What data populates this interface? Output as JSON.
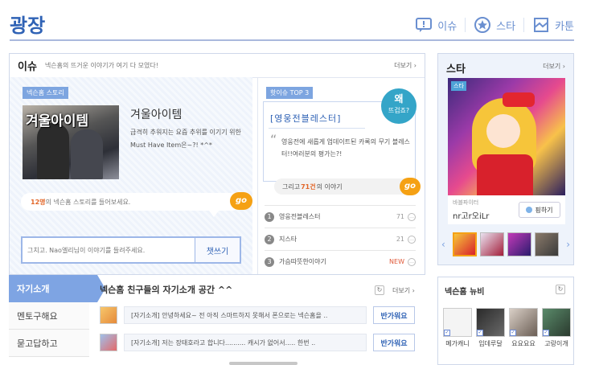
{
  "page": {
    "title": "광장"
  },
  "topnav": [
    {
      "label": "이슈",
      "icon": "issue-icon"
    },
    {
      "label": "스타",
      "icon": "star-icon"
    },
    {
      "label": "카툰",
      "icon": "cartoon-icon"
    }
  ],
  "issue": {
    "heading": "이슈",
    "subtitle": "넥슨홈의 뜨거운 이야기가 여기 다 모였다!",
    "more": "더보기",
    "story": {
      "tag": "넥슨홈 스토리",
      "image_label": "겨울아이템",
      "title": "겨울아이템",
      "desc": "급격히 추워지는 요즘 추위를 이기기 위한 Must Have Item은~?! *^*",
      "count": "12명",
      "count_suffix": "의 넥슨홈 스토리를 들어보세요.",
      "go": "go",
      "input_placeholder": "그치고. Nao엘리님이 이야기를 들려주세요.",
      "write_button": "챗쓰기"
    },
    "hot": {
      "tag": "핫이슈 TOP 3",
      "why": "왜",
      "why_sub": "뜨겁죠?",
      "title": "[영웅전블레스터]",
      "desc": "영웅전에 새롭게 업데이트된 카록의 무기 블레스터!!여러분의 평가는?!",
      "others_prefix": "그리고",
      "others_count": "71건",
      "others_suffix": "의 이야기",
      "go": "go",
      "ranks": [
        {
          "num": "1",
          "label": "영웅전블레스터",
          "value": "71"
        },
        {
          "num": "2",
          "label": "지스타",
          "value": "21"
        },
        {
          "num": "3",
          "label": "가슴따뜻한이야기",
          "value": "NEW"
        }
      ]
    }
  },
  "star": {
    "heading": "스타",
    "more": "더보기",
    "badge": "스타",
    "nick_label": "바블파이터",
    "name": "nr고r오iLr",
    "ping_button": "핑하기"
  },
  "newbie": {
    "heading": "넥슨홈 뉴비",
    "members": [
      {
        "name": "메가캐니"
      },
      {
        "name": "임데루달"
      },
      {
        "name": "요요요요"
      },
      {
        "name": "고랑이개"
      }
    ]
  },
  "sidebar": [
    {
      "label": "자기소개"
    },
    {
      "label": "멘토구해요"
    },
    {
      "label": "묻고답하고"
    }
  ],
  "intro": {
    "heading": "넥슨홈 친구들의 자기소개 공간 ^^",
    "more": "더보기",
    "rows": [
      {
        "text": "[자기소개] 안녕하세요~ 전 아직 스마트하지 못해서 폰으로는 넥슨홈을 ..",
        "button": "반가워요"
      },
      {
        "text": "[자기소개] 저는 장태호라고 합니다.......... 캐시가 없어서..... 한번 ..",
        "button": "반가워요"
      }
    ]
  }
}
